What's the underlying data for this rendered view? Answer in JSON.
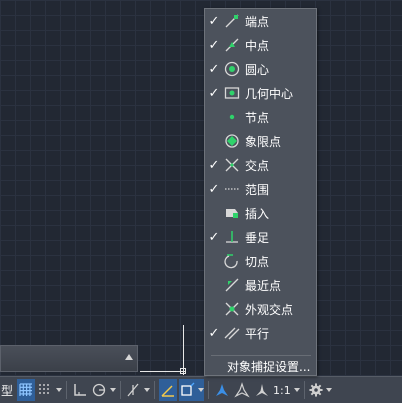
{
  "osnap_menu": {
    "items": [
      {
        "label": "端点",
        "checked": true,
        "icon": "endpoint-icon"
      },
      {
        "label": "中点",
        "checked": true,
        "icon": "midpoint-icon"
      },
      {
        "label": "圆心",
        "checked": true,
        "icon": "center-icon"
      },
      {
        "label": "几何中心",
        "checked": true,
        "icon": "geometric-center-icon"
      },
      {
        "label": "节点",
        "checked": false,
        "icon": "node-icon"
      },
      {
        "label": "象限点",
        "checked": false,
        "icon": "quadrant-icon"
      },
      {
        "label": "交点",
        "checked": true,
        "icon": "intersection-icon"
      },
      {
        "label": "范围",
        "checked": true,
        "icon": "extension-icon"
      },
      {
        "label": "插入",
        "checked": false,
        "icon": "insertion-icon"
      },
      {
        "label": "垂足",
        "checked": true,
        "icon": "perpendicular-icon"
      },
      {
        "label": "切点",
        "checked": false,
        "icon": "tangent-icon"
      },
      {
        "label": "最近点",
        "checked": false,
        "icon": "nearest-icon"
      },
      {
        "label": "外观交点",
        "checked": false,
        "icon": "apparent-intersection-icon"
      },
      {
        "label": "平行",
        "checked": true,
        "icon": "parallel-icon"
      }
    ],
    "settings_label": "对象捕捉设置..."
  },
  "status_bar": {
    "model_label": "型",
    "scale_label": "1:1"
  },
  "colors": {
    "canvas_bg": "#222833",
    "menu_bg": "#4c525c",
    "snap_green": "#2fd36b",
    "active_blue": "#2f5f99"
  }
}
